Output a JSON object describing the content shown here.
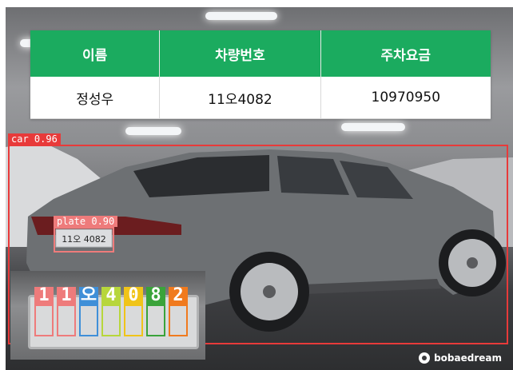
{
  "parking_table": {
    "headers": [
      "이름",
      "차량번호",
      "주차요금"
    ],
    "row": [
      "정성우",
      "11오4082",
      "10970950"
    ]
  },
  "detections": {
    "car": {
      "label": "car 0.96"
    },
    "plate": {
      "label": "plate 0.90",
      "text": "11오 4082"
    }
  },
  "inset": {
    "plate_text": "11오 4082",
    "characters": [
      {
        "label": "1",
        "color": "#ee7b7b"
      },
      {
        "label": "1",
        "color": "#ee7b7b"
      },
      {
        "label": "오",
        "color": "#3f8fd8"
      },
      {
        "label": "4",
        "color": "#b7d63b"
      },
      {
        "label": "0",
        "color": "#f0c419"
      },
      {
        "label": "8",
        "color": "#3aa33a"
      },
      {
        "label": "2",
        "color": "#f07a1e"
      }
    ]
  },
  "watermark": {
    "text": "bobaedream",
    "icon": "bobaedream-logo-icon"
  },
  "colors": {
    "table_header": "#1bab5f",
    "detection_box": "#e83a3a"
  }
}
